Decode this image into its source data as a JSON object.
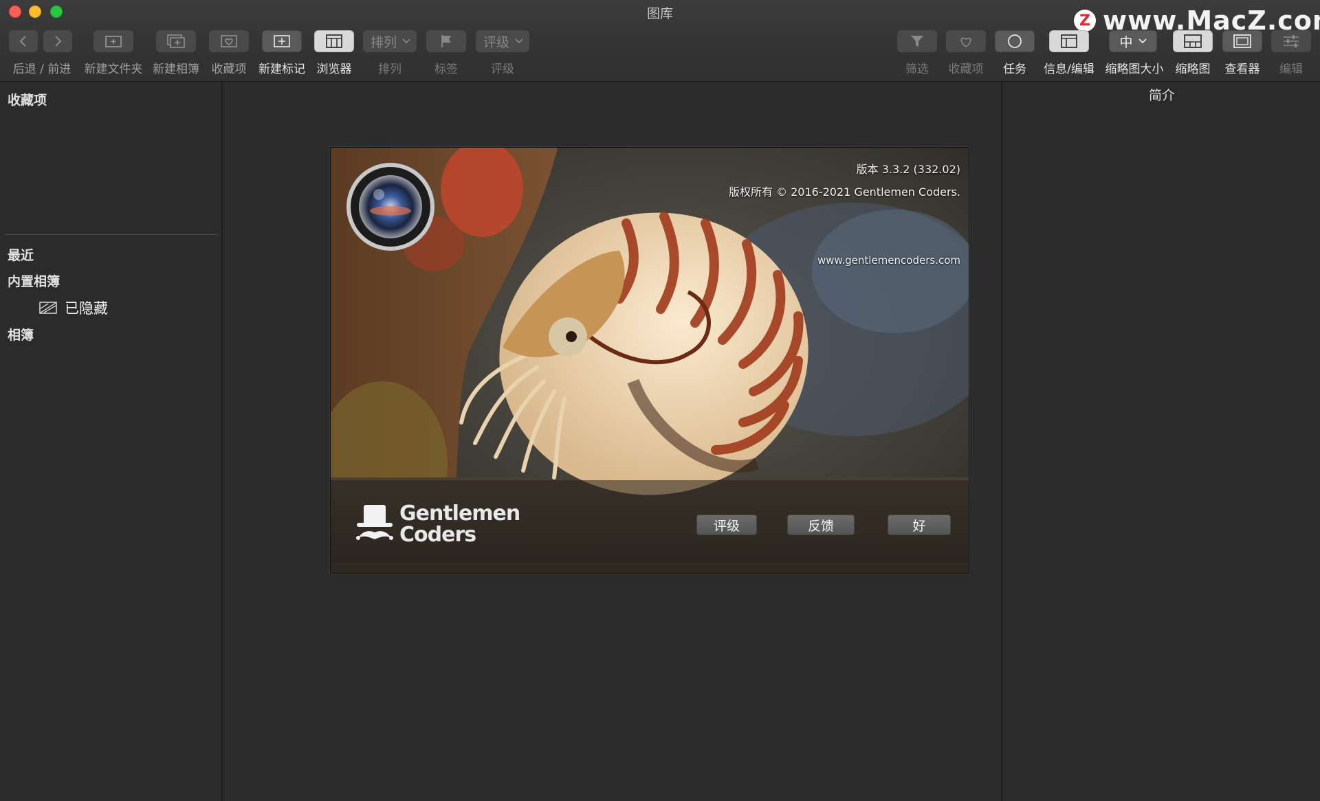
{
  "window": {
    "title": "图库"
  },
  "watermark": {
    "badge": "Z",
    "text": "www.MacZ.com"
  },
  "toolbar_left": [
    {
      "label": "后退 / 前进",
      "icon": "back-forward-icon"
    },
    {
      "label": "新建文件夹",
      "icon": "new-folder-icon"
    },
    {
      "label": "新建相簿",
      "icon": "new-album-icon"
    },
    {
      "label": "收藏项",
      "icon": "favorites-heart-icon"
    },
    {
      "label": "新建标记",
      "icon": "new-tag-icon"
    },
    {
      "label": "浏览器",
      "icon": "browser-icon"
    },
    {
      "label": "排列",
      "button": "排列",
      "icon": "sort-dropdown-icon"
    },
    {
      "label": "标签",
      "icon": "flag-icon"
    },
    {
      "label": "评级",
      "button": "评级",
      "icon": "rating-dropdown-icon"
    }
  ],
  "toolbar_right": [
    {
      "label": "筛选",
      "icon": "filter-icon"
    },
    {
      "label": "收藏项",
      "icon": "heart-icon"
    },
    {
      "label": "任务",
      "icon": "tasks-circle-icon"
    },
    {
      "label": "信息/编辑",
      "icon": "info-edit-icon"
    },
    {
      "label": "缩略图大小",
      "button": "中",
      "icon": "thumbnail-size-dropdown-icon"
    },
    {
      "label": "缩略图",
      "icon": "thumbnails-icon"
    },
    {
      "label": "查看器",
      "icon": "viewer-icon"
    },
    {
      "label": "编辑",
      "icon": "edit-sliders-icon"
    }
  ],
  "sidebar": {
    "favorites_header": "收藏项",
    "recent": "最近",
    "builtin_albums": "内置相簿",
    "hidden": "已隐藏",
    "albums": "相簿"
  },
  "info_panel": {
    "title": "简介"
  },
  "splash": {
    "version": "版本 3.3.2 (332.02)",
    "copyright": "版权所有 © 2016-2021 Gentlemen Coders.",
    "url": "www.gentlemencoders.com",
    "brand_line1": "Gentlemen",
    "brand_line2": "Coders",
    "buttons": {
      "rate": "评级",
      "feedback": "反馈",
      "ok": "好"
    }
  },
  "colors": {
    "traffic_close": "#fe5f57",
    "traffic_minimize": "#febc2e",
    "traffic_zoom": "#28c840",
    "toolbar_active": "#d9d9d9",
    "background": "#2b2b2b"
  }
}
